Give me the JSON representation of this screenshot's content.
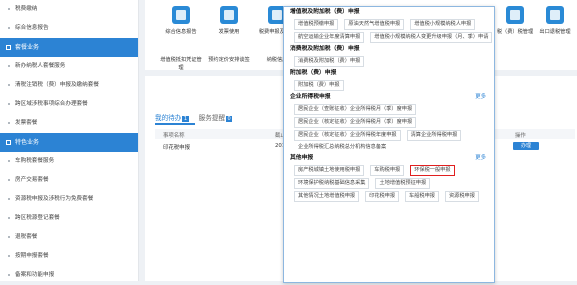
{
  "sidebar": {
    "items": [
      {
        "kind": "item",
        "label": "税费缴纳"
      },
      {
        "kind": "item",
        "label": "综合信息报告"
      },
      {
        "kind": "section",
        "label": "套餐业务"
      },
      {
        "kind": "item",
        "label": "新办纳税人套餐服务"
      },
      {
        "kind": "item",
        "label": "清税注销税（费）申报及缴纳套餐"
      },
      {
        "kind": "item",
        "label": "跨区域涉税事项综合办理套餐"
      },
      {
        "kind": "item",
        "label": "发票套餐"
      },
      {
        "kind": "section",
        "label": "特色业务"
      },
      {
        "kind": "item",
        "label": "车购税套餐服务"
      },
      {
        "kind": "item",
        "label": "房产交易套餐"
      },
      {
        "kind": "item",
        "label": "资源税申报及涉税行为免费套餐"
      },
      {
        "kind": "item",
        "label": "跨区税源登记套餐"
      },
      {
        "kind": "item",
        "label": "退税套餐"
      },
      {
        "kind": "item",
        "label": "按期申报套餐"
      },
      {
        "kind": "item",
        "label": "备案和功能申报"
      }
    ]
  },
  "top_icons": [
    {
      "label": "综合信息报告"
    },
    {
      "label": "发票使用"
    },
    {
      "label": "税费申报及缴纳"
    },
    {
      "label": "增值税抵扣凭证管理"
    },
    {
      "label": "预约定价安排谈签"
    },
    {
      "label": "纳税信用"
    }
  ],
  "right_icons": [
    {
      "label": "税（费）税管理"
    },
    {
      "label": "出口退税管理"
    }
  ],
  "tabs": [
    {
      "label": "我的待办",
      "badge": "1"
    },
    {
      "label": "服务提醒",
      "badge": "0"
    }
  ],
  "table": {
    "headers": [
      "事项名称",
      "截止",
      "操作"
    ],
    "rows": [
      {
        "name": "印花税申报",
        "date": "2019",
        "action": "办理"
      }
    ]
  },
  "popup": {
    "sections": [
      {
        "title": "增值税及附加税（费）申报",
        "more": "",
        "links": [
          "增值税预缴申报",
          "原油天然气增值税申报",
          "增值税小规模纳税人申报",
          "航空运输企业年度清算申报",
          "增值税小规模纳税人变更升级申报（月、季）申请"
        ]
      },
      {
        "title": "消费税及附加税（费）申报",
        "more": "",
        "links": [
          "消费税及附加税（费）申报"
        ]
      },
      {
        "title": "附加税（费）申报",
        "more": "",
        "links": [
          "附加税（费）申报"
        ]
      },
      {
        "title": "企业所得税申报",
        "more": "更多",
        "links": [
          "居民企业（查账征收）企业所得税月（季）度申报",
          "居民企业（核定征收）企业所得税月（季）度申报",
          "居民企业（核定征收）企业所得税年度申报",
          "清算企业所得税申报"
        ],
        "plain": "企业所得税汇总纳税总分机构信息备案"
      },
      {
        "title": "其他申报",
        "more": "更多",
        "links": [
          "房产税城镇土地使用税申报",
          "车购税申报",
          "环保税一般申报",
          "环境保护税纳税基础信息采集",
          "土地增值税预征申报",
          "其他情况土地增值税申报",
          "印花税申报",
          "车船税申报",
          "资源税申报"
        ]
      }
    ],
    "selected": "环保税一般申报"
  },
  "colors": {
    "accent": "#2c83d4",
    "highlight": "#e02020"
  }
}
